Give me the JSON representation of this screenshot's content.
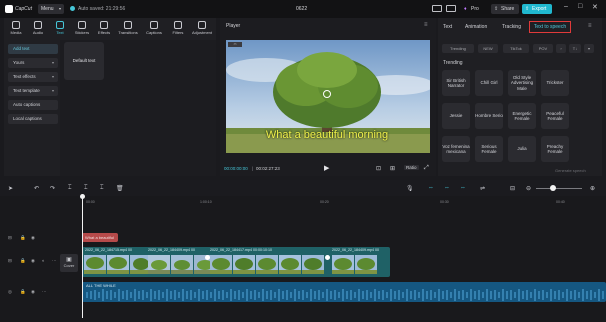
{
  "titlebar": {
    "app_name": "CapCut",
    "menu_label": "Menu",
    "autosave": "Auto saved: 21:29:56",
    "project_name": "0622",
    "pro_label": "Pro",
    "share_label": "Share",
    "export_label": "Export"
  },
  "toolbar": {
    "items": [
      {
        "label": "Media",
        "icon": "media-icon"
      },
      {
        "label": "Audio",
        "icon": "audio-icon"
      },
      {
        "label": "Text",
        "icon": "text-icon"
      },
      {
        "label": "Stickers",
        "icon": "stickers-icon"
      },
      {
        "label": "Effects",
        "icon": "effects-icon"
      },
      {
        "label": "Transitions",
        "icon": "transitions-icon"
      },
      {
        "label": "Captions",
        "icon": "captions-icon"
      },
      {
        "label": "Filters",
        "icon": "filters-icon"
      },
      {
        "label": "Adjustment",
        "icon": "adjustment-icon"
      }
    ],
    "active": "Text"
  },
  "leftnav": {
    "add_text": "Add text",
    "yours": "Yours",
    "text_effects": "Text effects",
    "text_template": "Text template",
    "auto_captions": "Auto captions",
    "local_captions": "Local captions"
  },
  "leftcontent": {
    "default_text": "Default text"
  },
  "player": {
    "title": "Player",
    "caption": "What a beautiful morning",
    "current_time": "00:00:00:00",
    "total_time": "00:02:27:23",
    "ratio_label": "Ratio"
  },
  "rightpanel": {
    "tabs": [
      "Text",
      "Animation",
      "Tracking",
      "Text to speech"
    ],
    "active_tab": "Text to speech",
    "filters": [
      "Trending",
      "NEW",
      "TikTok",
      "POV"
    ],
    "section": "Trending",
    "voices": [
      "Sir British Narrator",
      "Chill Girl",
      "Old Style Advertising Male",
      "Trickster",
      "Jessie",
      "Hombre Serio",
      "Energetic Female",
      "Peaceful Female",
      "Voz femenina mexicana",
      "Serious Female",
      "Julia",
      "Preachy Female"
    ],
    "generate_label": "Generate speech"
  },
  "timeline": {
    "ruler": [
      "00:00",
      "1:00:10",
      "00:20",
      "00:30",
      "00:40"
    ],
    "text_clip": "What a beautiful",
    "cover_label": "Cover",
    "clips": [
      "2022_06_22_184715.mp4  00",
      "2022_06_22_184409.mp4  00",
      "2022_06_22_184417.mp4  00:00:10:10",
      "2022_06_22_184409.mp4  00"
    ],
    "audio_label": "ALL THE WHILE"
  },
  "colors": {
    "accent": "#46c6d8",
    "caption": "#eef04a",
    "video_track": "#1f6166",
    "audio_track": "#155781",
    "text_clip": "#b64a4a",
    "highlight_box": "#e03a3a"
  }
}
